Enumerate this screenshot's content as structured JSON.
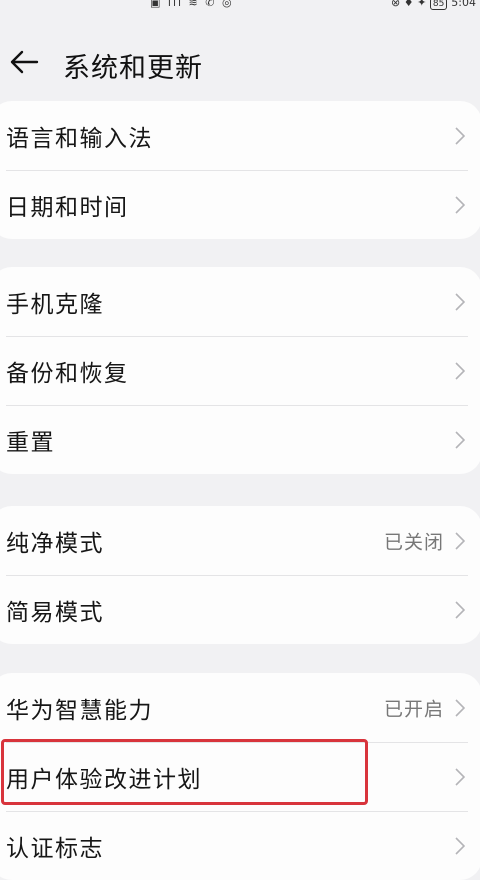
{
  "header": {
    "title": "系统和更新"
  },
  "status_bar": {
    "time": "5:04",
    "battery": "85"
  },
  "groups": [
    {
      "items": [
        {
          "label": "语言和输入法",
          "value": ""
        },
        {
          "label": "日期和时间",
          "value": ""
        }
      ]
    },
    {
      "items": [
        {
          "label": "手机克隆",
          "value": ""
        },
        {
          "label": "备份和恢复",
          "value": ""
        },
        {
          "label": "重置",
          "value": ""
        }
      ]
    },
    {
      "items": [
        {
          "label": "纯净模式",
          "value": "已关闭"
        },
        {
          "label": "简易模式",
          "value": ""
        }
      ]
    },
    {
      "items": [
        {
          "label": "华为智慧能力",
          "value": "已开启"
        },
        {
          "label": "用户体验改进计划",
          "value": ""
        },
        {
          "label": "认证标志",
          "value": ""
        }
      ]
    }
  ],
  "colors": {
    "background": "#f1f1f3",
    "card": "#fdfdfd",
    "highlight": "#d8343c"
  }
}
